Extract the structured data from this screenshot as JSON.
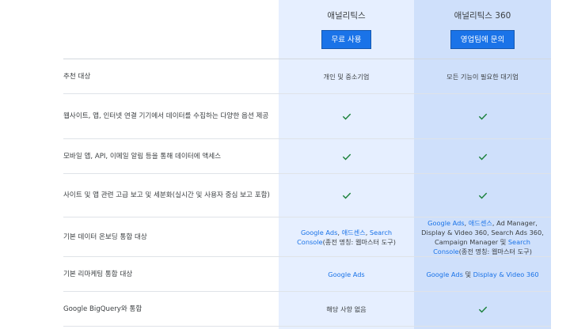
{
  "columns": {
    "standard": {
      "name": "애널리틱스",
      "button": "무료 사용"
    },
    "premium": {
      "name": "애널리틱스 360",
      "button": "영업팀에 문의"
    }
  },
  "rows": [
    {
      "label": "추천 대상",
      "standard": "개인 및 중소기업",
      "premium": "모든 기능이 필요한 대기업"
    },
    {
      "label": "웹사이트, 앱, 인터넷 연결 기기에서 데이터를 수집하는 다양한 옵션 제공",
      "standard": "check",
      "premium": "check"
    },
    {
      "label": "모바일 앱, API, 이메일 알림 등을 통해 데이터에 액세스",
      "standard": "check",
      "premium": "check"
    },
    {
      "label": "사이트 및 앱 관련 고급 보고 및 세분화(실시간 및 사용자 중심 보고 포함)",
      "standard": "check",
      "premium": "check"
    },
    {
      "label": "기본 데이터 온보딩 통합 대상",
      "standard_parts": [
        {
          "t": "Google Ads",
          "link": true
        },
        {
          "t": ", ",
          "link": false
        },
        {
          "t": "애드센스",
          "link": true
        },
        {
          "t": ", ",
          "link": false
        },
        {
          "t": "Search Console",
          "link": true
        },
        {
          "t": "(종전 명칭: 웹마스터 도구)",
          "link": false
        }
      ],
      "premium_parts": [
        {
          "t": "Google Ads",
          "link": true
        },
        {
          "t": ", ",
          "link": false
        },
        {
          "t": "애드센스",
          "link": true
        },
        {
          "t": ", Ad Manager, Display & Video 360, Search Ads 360, Campaign Manager 및 ",
          "link": false
        },
        {
          "t": "Search Console",
          "link": true
        },
        {
          "t": "(종전 명칭: 웹마스터 도구)",
          "link": false
        }
      ]
    },
    {
      "label": "기본 리마케팅 통합 대상",
      "standard_parts": [
        {
          "t": "Google Ads",
          "link": true
        }
      ],
      "premium_parts": [
        {
          "t": "Google Ads",
          "link": true
        },
        {
          "t": " 및 ",
          "link": false
        },
        {
          "t": "Display & Video 360",
          "link": true
        }
      ]
    },
    {
      "label": "Google BigQuery와 통합",
      "standard": "해당 사항 없음",
      "premium": "check"
    }
  ],
  "colors": {
    "accent": "#1a73e8",
    "check": "#188038",
    "col_standard": "#e6efff",
    "col_premium": "#cfe0fb"
  }
}
